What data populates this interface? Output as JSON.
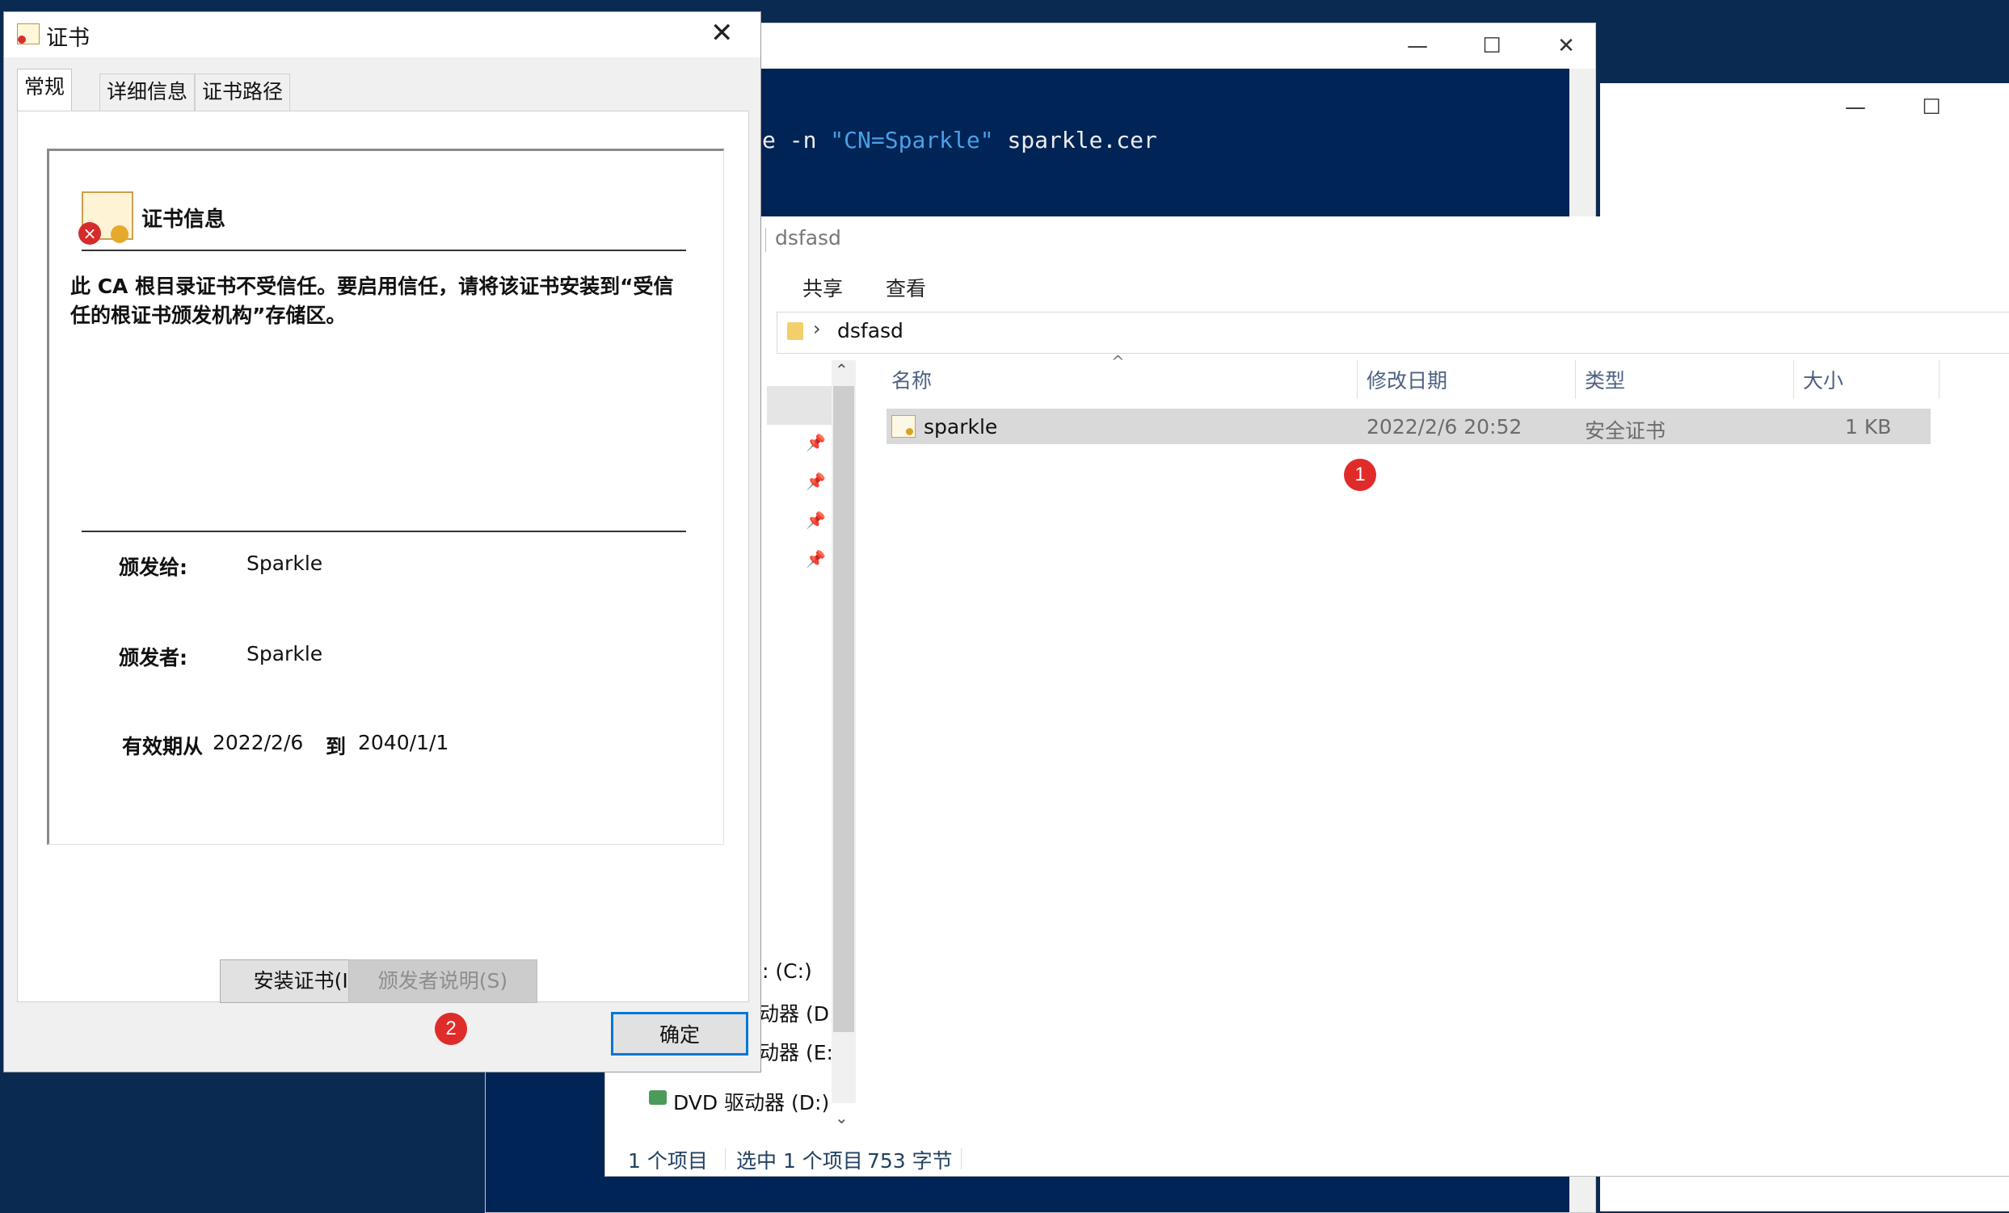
{
  "powershell": {
    "command_pre": "e -n ",
    "command_str": "\"CN=Sparkle\"",
    "command_post": " sparkle.cer",
    "minimize": "—",
    "maximize": "☐",
    "close": "✕"
  },
  "background_window": {
    "minimize": "—",
    "maximize": "☐"
  },
  "explorer": {
    "title": "dsfasd",
    "ribbon_tabs": [
      "共享",
      "查看"
    ],
    "address": "dsfasd",
    "sort_arrow": "^",
    "columns": [
      "名称",
      "修改日期",
      "类型",
      "大小"
    ],
    "file": {
      "name": "sparkle",
      "modified": "2022/2/6 20:52",
      "type": "安全证书",
      "size": "1 KB"
    },
    "nav_items": [
      ": (C:)",
      "动器 (D:)",
      "动器 (E:)",
      "DVD 驱动器 (D:) C"
    ],
    "scroll_up": "⌃",
    "scroll_down": "⌄",
    "status": {
      "count": "1 个项目",
      "selected": "选中 1 个项目",
      "size": "753 字节"
    }
  },
  "annotations": {
    "badge1": "1",
    "badge2": "2"
  },
  "cert_dialog": {
    "title": "证书",
    "close": "✕",
    "tabs": [
      "常规",
      "详细信息",
      "证书路径"
    ],
    "info_heading": "证书信息",
    "warning": "此 CA 根目录证书不受信任。要启用信任，请将该证书安装到“受信任的根证书颁发机构”存储区。",
    "issued_to_label": "颁发给:",
    "issued_to": "Sparkle",
    "issued_by_label": "颁发者:",
    "issued_by": "Sparkle",
    "valid_from_label": "有效期从",
    "valid_from": "2022/2/6",
    "valid_to_label": "到",
    "valid_to": "2040/1/1",
    "install_button": "安装证书(I)...",
    "issuer_statement_button": "颁发者说明(S)",
    "ok_button": "确定"
  },
  "colors": {
    "console_bg": "#012456",
    "accent": "#0078d7",
    "badge": "#e02b2b"
  }
}
